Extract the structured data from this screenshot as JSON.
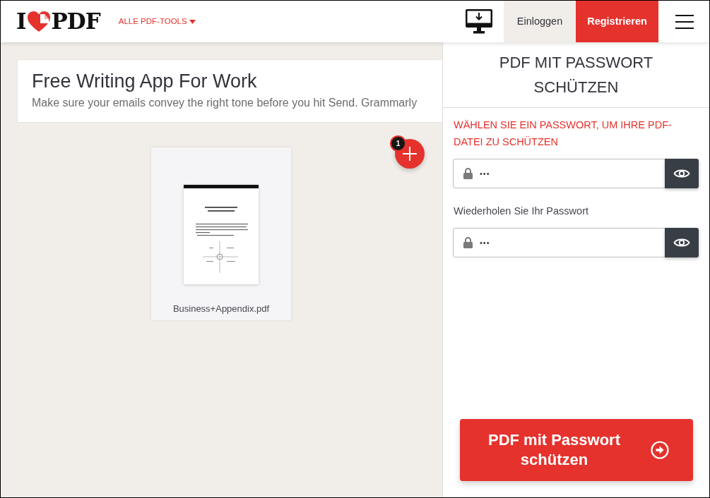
{
  "header": {
    "logo": {
      "letter": "I",
      "wordmark": "PDF"
    },
    "tools_menu": "ALLE PDF-TOOLS",
    "login_button": "Einloggen",
    "register_button": "Registrieren"
  },
  "ad": {
    "title": "Free Writing App For Work",
    "text": "Make sure your emails convey the right tone before you hit Send. Grammarly"
  },
  "add_files": {
    "count": "1"
  },
  "files": [
    {
      "name": "Business+Appendix.pdf"
    }
  ],
  "panel": {
    "title": "PDF MIT PASSWORT SCHÜTZEN",
    "prompt": "WÄHLEN SIE EIN PASSWORT, UM IHRE PDF-DATEI ZU SCHÜTZEN",
    "fields": [
      {
        "value": "•••"
      },
      {
        "label": "Wiederholen Sie Ihr Passwort",
        "value": "•••"
      }
    ],
    "submit_button": "PDF mit Passwort schützen"
  }
}
